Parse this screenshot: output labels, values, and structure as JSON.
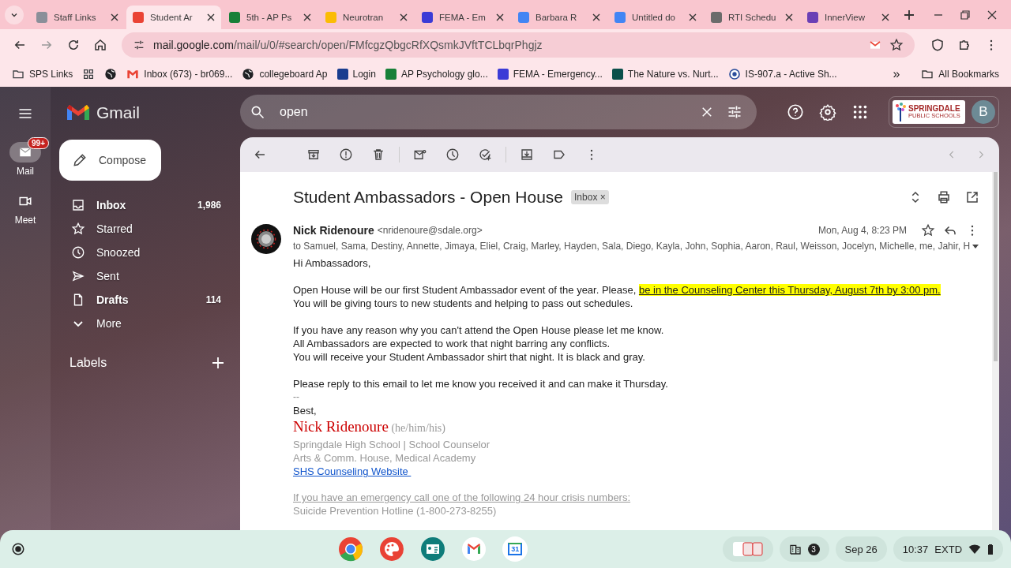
{
  "browser": {
    "tabs": [
      {
        "title": "Staff Links",
        "selected": false,
        "color": "#8a8f99"
      },
      {
        "title": "Student Ar",
        "selected": true,
        "color": "#ea4335"
      },
      {
        "title": "5th - AP Ps",
        "selected": false,
        "color": "#188038"
      },
      {
        "title": "Neurotran",
        "selected": false,
        "color": "#fbbc04"
      },
      {
        "title": "FEMA - Em",
        "selected": false,
        "color": "#3b3bd6"
      },
      {
        "title": "Barbara R",
        "selected": false,
        "color": "#4285f4"
      },
      {
        "title": "Untitled do",
        "selected": false,
        "color": "#4285f4"
      },
      {
        "title": "RTI Schedu",
        "selected": false,
        "color": "#6b6b6b"
      },
      {
        "title": "InnerView",
        "selected": false,
        "color": "#6a3fb5"
      }
    ],
    "url": {
      "host": "mail.google.com",
      "path": "/mail/u/0/#search/open/FMfcgzQbgcRfXQsmkJVftTCLbqrPhgjz"
    },
    "bookmarks": [
      {
        "label": "SPS Links",
        "kind": "folder",
        "color": "#3c4043"
      },
      {
        "kind": "apps",
        "color": "#3c4043"
      },
      {
        "kind": "globe",
        "color": "#202124"
      },
      {
        "label": "Inbox (673) - br069...",
        "kind": "gmail",
        "color": "#ea4335"
      },
      {
        "label": "collegeboard Ap",
        "kind": "globe",
        "color": "#202124"
      },
      {
        "label": "Login",
        "kind": "square",
        "color": "#1a3d8f"
      },
      {
        "label": "AP Psychology glo...",
        "kind": "square",
        "color": "#188038"
      },
      {
        "label": "FEMA - Emergency...",
        "kind": "square",
        "color": "#3b3bd6"
      },
      {
        "label": "The Nature vs. Nurt...",
        "kind": "square",
        "color": "#0b4f4a"
      },
      {
        "label": "IS-907.a - Active Sh...",
        "kind": "seal",
        "color": "#2a4d9b"
      }
    ],
    "more_bookmarks": "»",
    "all_bookmarks": "All Bookmarks"
  },
  "gmail": {
    "product": "Gmail",
    "rail": [
      {
        "label": "Mail",
        "kind": "mail",
        "selected": true,
        "badge": "99+"
      },
      {
        "label": "Meet",
        "kind": "video",
        "selected": false
      }
    ],
    "compose": "Compose",
    "nav": [
      {
        "label": "Inbox",
        "kind": "inbox",
        "count": "1,986",
        "unread": true
      },
      {
        "label": "Starred",
        "kind": "star",
        "unread": false
      },
      {
        "label": "Snoozed",
        "kind": "clock",
        "unread": false
      },
      {
        "label": "Sent",
        "kind": "send",
        "unread": false
      },
      {
        "label": "Drafts",
        "kind": "draft",
        "count": "114",
        "unread": true
      },
      {
        "label": "More",
        "kind": "chevron",
        "unread": false
      }
    ],
    "labels_heading": "Labels",
    "search": {
      "value": "open"
    },
    "org_logo": {
      "name": "SPRINGDALE",
      "sub": "PUBLIC SCHOOLS"
    },
    "avatar": "B",
    "message": {
      "subject": "Student Ambassadors - Open House",
      "label": "Inbox",
      "label_close": "×",
      "sender": "Nick Ridenoure",
      "address": "<nridenoure@sdale.org>",
      "date": "Mon, Aug 4, 8:23 PM",
      "recipients": "to Samuel, Sama, Destiny, Annette, Jimaya, Eliel, Craig, Marley, Hayden, Sala, Diego, Kayla, John, Sophia, Aaron, Raul, Weisson, Jocelyn, Michelle, me, Jahir, H",
      "paragraphs": [
        [
          {
            "text": "Hi Ambassadors,"
          }
        ],
        [
          {
            "text": "Open House will be our first Student Ambassador event of the year. Please, ",
            "highlight": "be in the Counseling Center this Thursday, August 7th by 3:00 pm."
          },
          {
            "text": "You will be giving tours to new students and helping to pass out schedules."
          }
        ],
        [
          {
            "text": "If you have any reason why you can't attend the Open House please let me know."
          },
          {
            "text": "All Ambassadors are expected to work that night barring any conflicts."
          },
          {
            "text": "You will receive your Student Ambassador shirt that night. It is black and gray."
          }
        ],
        [
          {
            "text": "Please reply to this email to let me know you received it and can make it Thursday."
          }
        ]
      ],
      "separator": "--",
      "closing": "Best,",
      "signature": {
        "name": "Nick Ridenoure",
        "pronouns": "(he/him/his)",
        "lines": [
          "Springdale High School | School Counselor",
          "Arts & Comm. House, Medical Academy"
        ],
        "link": "SHS Counseling Website ",
        "emergency": "If you have an emergency call one of the following 24 hour crisis numbers:",
        "hotline": "Suicide Prevention Hotline (1-800-273-8255)"
      }
    }
  },
  "shelf": {
    "calendar_day": "31",
    "notifications": "3",
    "date": "Sep 26",
    "time": "10:37",
    "display_mode": "EXTD"
  }
}
